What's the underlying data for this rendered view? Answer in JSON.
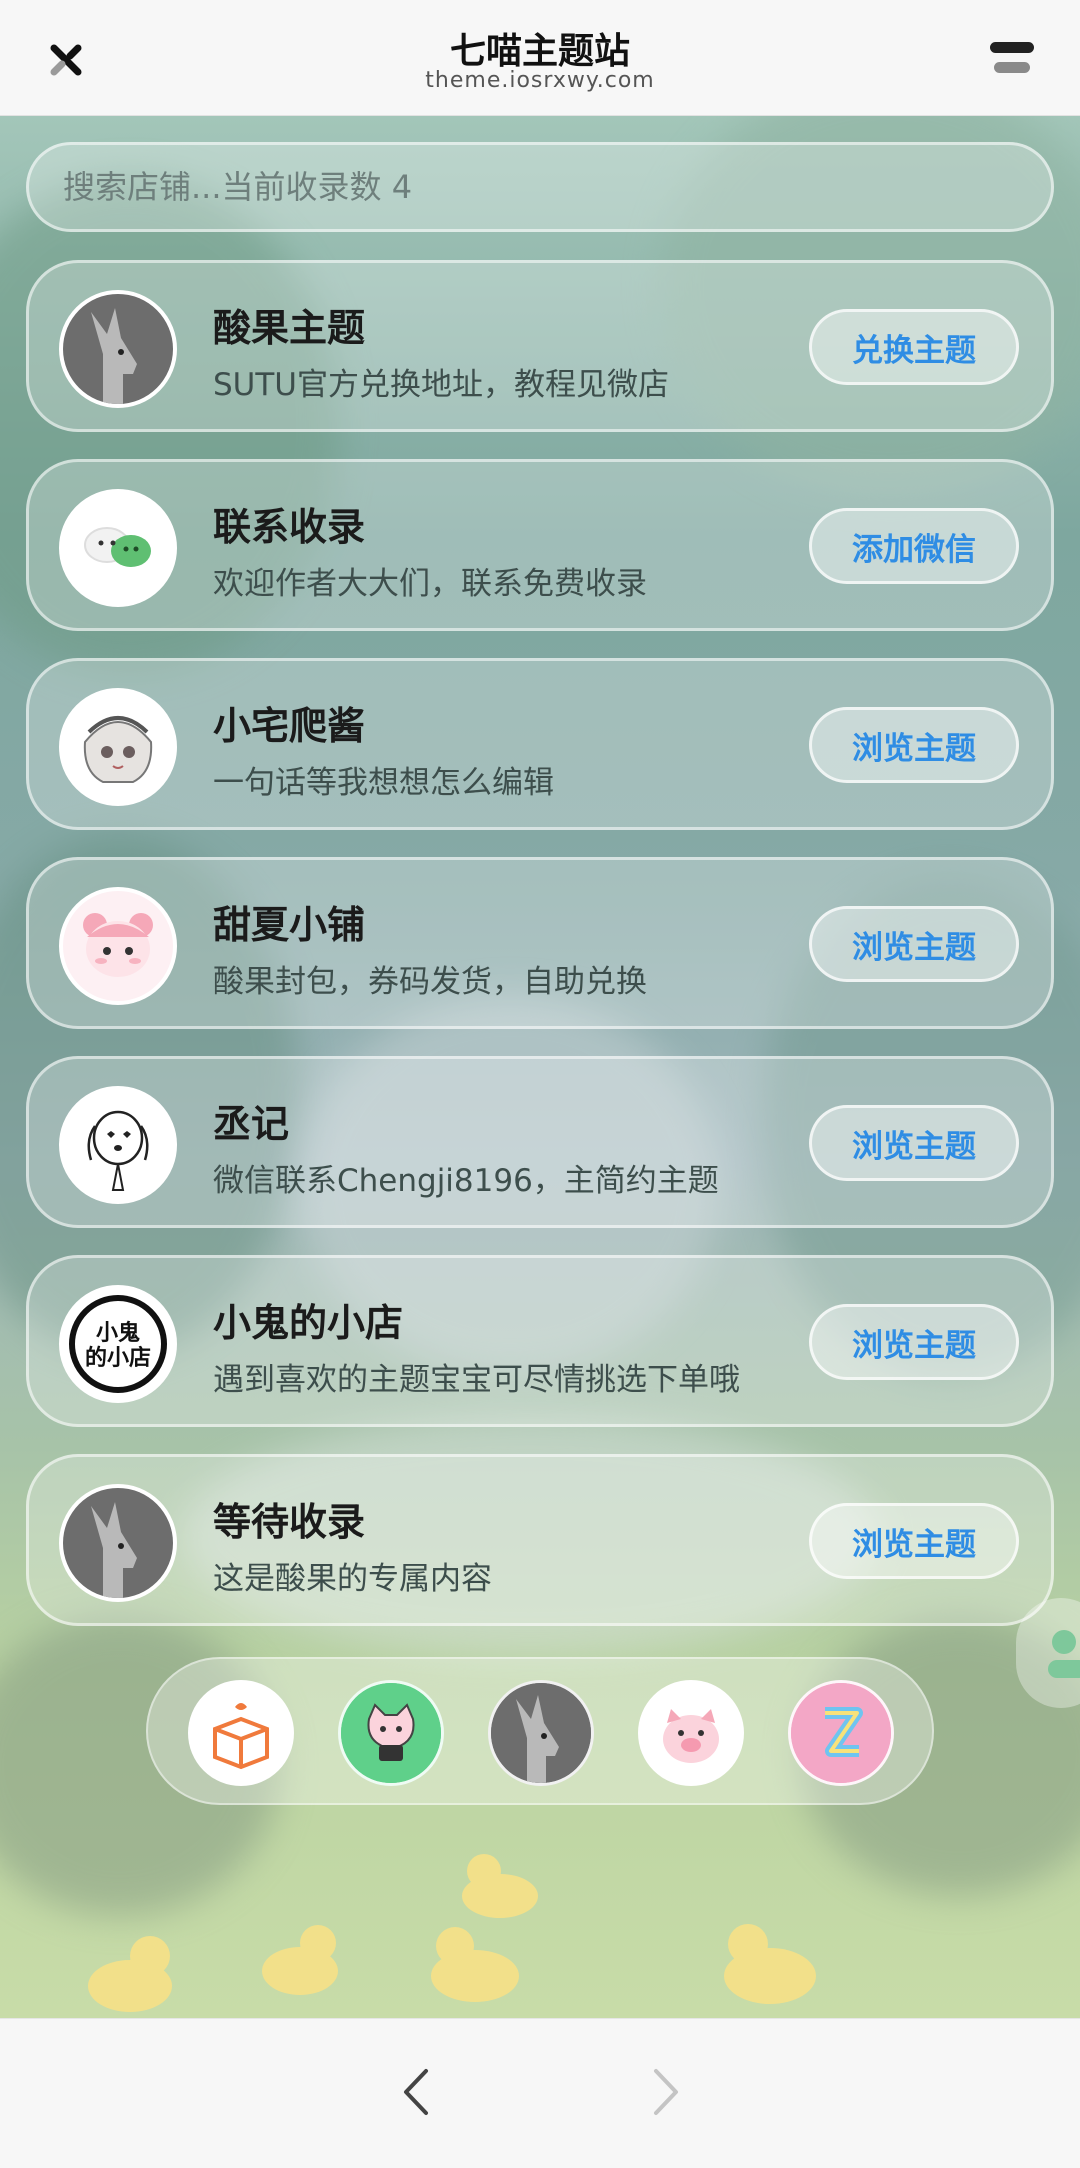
{
  "header": {
    "title": "七喵主题站",
    "subtitle": "theme.iosrxwy.com"
  },
  "search": {
    "placeholder": "搜索店铺...当前收录数 4"
  },
  "shops": [
    {
      "name": "酸果主题",
      "desc": "SUTU官方兑换地址，教程见微店",
      "button": "兑换主题",
      "avatar_icon": "donkey-avatar-icon"
    },
    {
      "name": "联系收录",
      "desc": "欢迎作者大大们，联系免费收录",
      "button": "添加微信",
      "avatar_icon": "wechat-bubbles-icon"
    },
    {
      "name": "小宅爬酱",
      "desc": "一句话等我想想怎么编辑",
      "button": "浏览主题",
      "avatar_icon": "anime-girl-avatar-icon"
    },
    {
      "name": "甜夏小铺",
      "desc": "酸果封包，券码发货，自助兑换",
      "button": "浏览主题",
      "avatar_icon": "pink-bear-avatar-icon"
    },
    {
      "name": "丞记",
      "desc": "微信联系Chengji8196，主简约主题",
      "button": "浏览主题",
      "avatar_icon": "dog-sketch-avatar-icon"
    },
    {
      "name": "小鬼的小店",
      "desc": "遇到喜欢的主题宝宝可尽情挑选下单哦",
      "button": "浏览主题",
      "avatar_icon": "ghost-shop-logo-icon",
      "logo_text": "小鬼的小店"
    },
    {
      "name": "等待收录",
      "desc": "这是酸果的专属内容",
      "button": "浏览主题",
      "avatar_icon": "donkey-avatar-icon"
    }
  ],
  "dock": [
    {
      "icon": "gift-box-icon"
    },
    {
      "icon": "cat-phone-icon"
    },
    {
      "icon": "donkey-avatar-icon"
    },
    {
      "icon": "pink-pig-icon"
    },
    {
      "icon": "z-letter-icon"
    }
  ],
  "colors": {
    "accent": "#2f8de4",
    "menu_bar_top": "#222222",
    "menu_bar_bottom": "#8a8a8a"
  }
}
